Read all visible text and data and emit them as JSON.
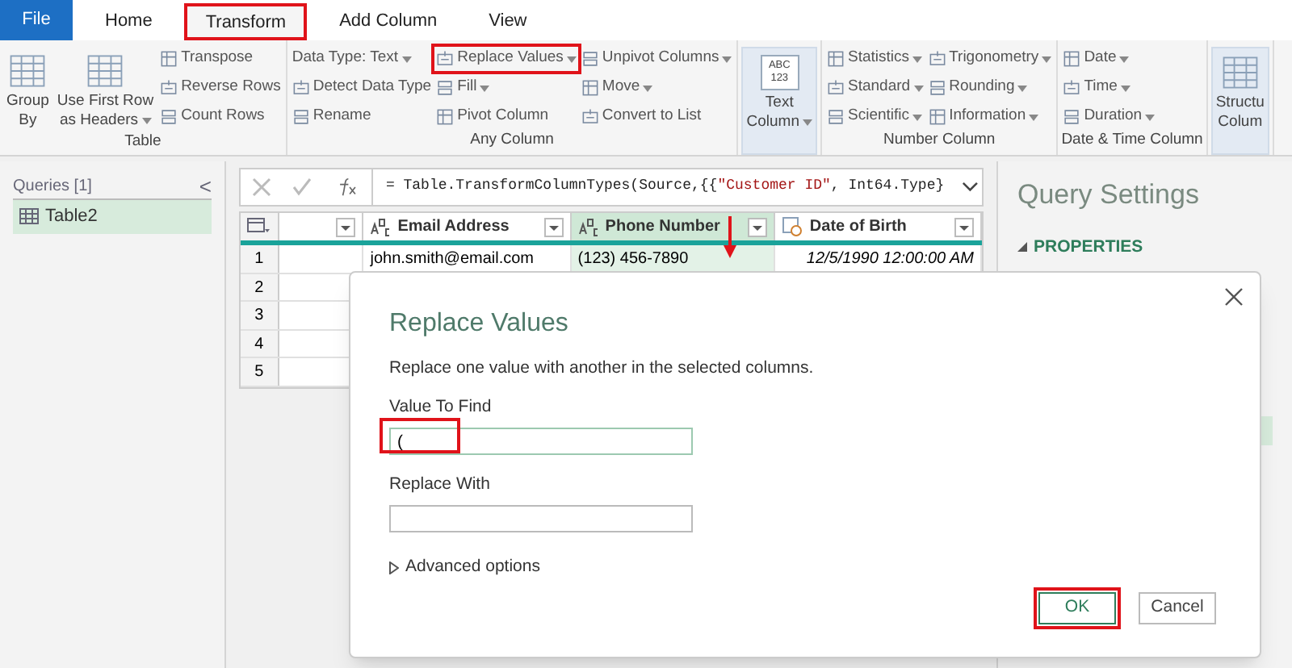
{
  "tabs": [
    {
      "label": "File",
      "kind": "file",
      "selected": false,
      "highlighted": false
    },
    {
      "label": "Home",
      "kind": "tab",
      "selected": false,
      "highlighted": false
    },
    {
      "label": "Transform",
      "kind": "tab",
      "selected": true,
      "highlighted": true
    },
    {
      "label": "Add Column",
      "kind": "tab",
      "selected": false,
      "highlighted": false
    },
    {
      "label": "View",
      "kind": "tab",
      "selected": false,
      "highlighted": false
    }
  ],
  "ribbon": [
    {
      "label": "Table",
      "large": [
        {
          "lines": [
            "Group",
            "By"
          ],
          "dropdown": false,
          "pressed": false
        },
        {
          "lines": [
            "Use First Row",
            "as Headers"
          ],
          "dropdown": true,
          "pressed": false
        }
      ],
      "columns": [
        [
          {
            "label": "Transpose",
            "dropdown": false,
            "highlighted": false
          },
          {
            "label": "Reverse Rows",
            "dropdown": false,
            "highlighted": false
          },
          {
            "label": "Count Rows",
            "dropdown": false,
            "highlighted": false
          }
        ]
      ]
    },
    {
      "label": "Any Column",
      "columns": [
        [
          {
            "label": "Data Type: Text",
            "dropdown": true,
            "highlighted": false,
            "icon": false
          },
          {
            "label": "Detect Data Type",
            "dropdown": false,
            "highlighted": false
          },
          {
            "label": "Rename",
            "dropdown": false,
            "highlighted": false
          }
        ],
        [
          {
            "label": "Replace Values",
            "dropdown": true,
            "highlighted": true
          },
          {
            "label": "Fill",
            "dropdown": true,
            "highlighted": false
          },
          {
            "label": "Pivot Column",
            "dropdown": false,
            "highlighted": false
          }
        ],
        [
          {
            "label": "Unpivot Columns",
            "dropdown": true,
            "highlighted": false
          },
          {
            "label": "Move",
            "dropdown": true,
            "highlighted": false
          },
          {
            "label": "Convert to List",
            "dropdown": false,
            "highlighted": false
          }
        ]
      ]
    },
    {
      "large": [
        {
          "lines": [
            "Text",
            "Column"
          ],
          "dropdown": true,
          "pressed": true,
          "badge": "ABC 123"
        }
      ]
    },
    {
      "label": "Number Column",
      "columns": [
        [
          {
            "label": "Statistics",
            "dropdown": true,
            "highlighted": false
          },
          {
            "label": "Standard",
            "dropdown": true,
            "highlighted": false
          },
          {
            "label": "Scientific",
            "dropdown": true,
            "highlighted": false
          }
        ],
        [
          {
            "label": "Trigonometry",
            "dropdown": true,
            "highlighted": false
          },
          {
            "label": "Rounding",
            "dropdown": true,
            "highlighted": false
          },
          {
            "label": "Information",
            "dropdown": true,
            "highlighted": false
          }
        ]
      ]
    },
    {
      "label": "Date & Time Column",
      "columns": [
        [
          {
            "label": "Date",
            "dropdown": true,
            "highlighted": false
          },
          {
            "label": "Time",
            "dropdown": true,
            "highlighted": false
          },
          {
            "label": "Duration",
            "dropdown": true,
            "highlighted": false
          }
        ]
      ]
    },
    {
      "large": [
        {
          "lines": [
            "Structu",
            "Colum"
          ],
          "dropdown": false,
          "pressed": true
        }
      ]
    }
  ],
  "queries": {
    "title": "Queries [1]",
    "collapse": "<",
    "items": [
      {
        "label": "Table2",
        "selected": true
      }
    ]
  },
  "formula_bar": {
    "parts": [
      {
        "text": "= Table.TransformColumnTypes(Source,{{",
        "kind": "code"
      },
      {
        "text": "\"Customer ID\"",
        "kind": "string"
      },
      {
        "text": ", Int64.Type}",
        "kind": "code"
      }
    ]
  },
  "table": {
    "columns": [
      {
        "kind": "none",
        "selected": false,
        "arrow": false
      },
      {
        "label": "Email Address",
        "kind": "text",
        "selected": false,
        "arrow": false
      },
      {
        "label": "Phone Number",
        "kind": "text",
        "selected": true,
        "arrow": true
      },
      {
        "label": "Date of Birth",
        "kind": "datetime",
        "selected": false,
        "arrow": false
      }
    ],
    "rows": [
      {
        "number": "1",
        "cells": [
          "",
          "john.smith@email.com",
          "(123) 456-7890",
          "12/5/1990 12:00:00 AM"
        ]
      },
      {
        "number": "2"
      },
      {
        "number": "3"
      },
      {
        "number": "4"
      },
      {
        "number": "5"
      }
    ]
  },
  "query_settings": {
    "title": "Query Settings",
    "section": "PROPERTIES"
  },
  "dialog": {
    "title": "Replace Values",
    "description": "Replace one value with another in the selected columns.",
    "fields": [
      {
        "label": "Value To Find",
        "value": "(",
        "highlighted": true
      },
      {
        "label": "Replace With",
        "highlighted": false
      }
    ],
    "advanced": {
      "label": "Advanced options",
      "expanded": false
    },
    "buttons": [
      {
        "label": "OK",
        "primary": true,
        "highlighted": true
      },
      {
        "label": "Cancel",
        "primary": false,
        "highlighted": false
      }
    ]
  }
}
